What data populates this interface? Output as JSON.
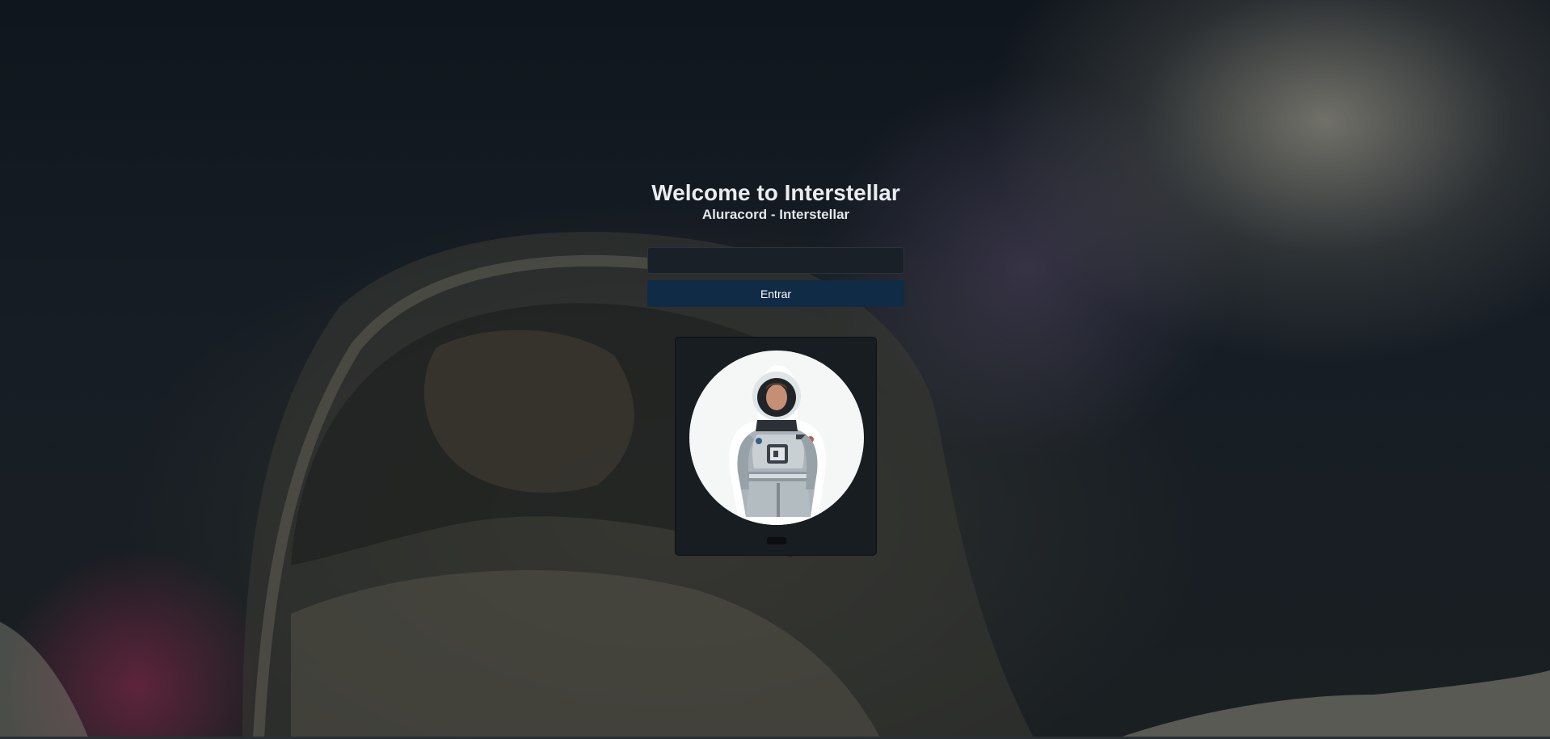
{
  "page": {
    "title": "Welcome to Interstellar",
    "subtitle": "Aluracord - Interstellar"
  },
  "form": {
    "username_value": "",
    "username_placeholder": "",
    "submit_label": "Entrar"
  },
  "profile": {
    "username": "",
    "avatar_icon": "astronaut-icon"
  },
  "background": {
    "description_icon": "astronaut-helmet-background"
  },
  "colors": {
    "button_bg": "#0f2b45",
    "input_bg": "#1a2027",
    "card_bg": "#181d22",
    "title_text": "#e9edf1"
  }
}
